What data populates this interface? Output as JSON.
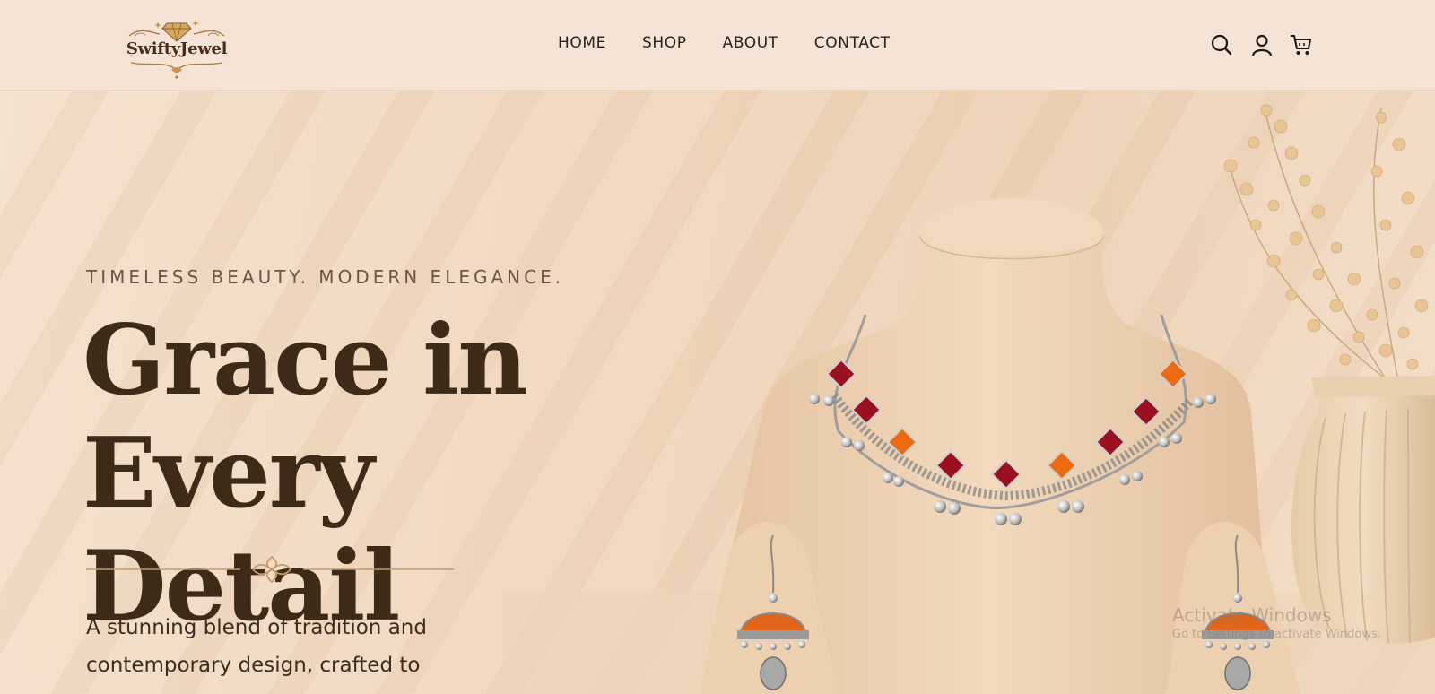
{
  "brand": {
    "name": "SwiftyJewel"
  },
  "nav": {
    "items": [
      "HOME",
      "SHOP",
      "ABOUT",
      "CONTACT"
    ]
  },
  "icons": [
    "search-icon",
    "user-icon",
    "cart-icon"
  ],
  "hero": {
    "eyebrow": "TIMELESS BEAUTY. MODERN ELEGANCE.",
    "headline_line1": "Grace in",
    "headline_line2": "Every Detail",
    "subtext": "A stunning blend of tradition and contemporary design, crafted to"
  },
  "watermark": {
    "line1": "Activate Windows",
    "line2": "Go to Settings to activate Windows."
  },
  "colors": {
    "header_bg": "#f5e4d5",
    "headline": "#3e2a18",
    "accent_gold": "#c49a6c",
    "stone_red": "#9b1020",
    "stone_orange": "#ee6a10"
  }
}
